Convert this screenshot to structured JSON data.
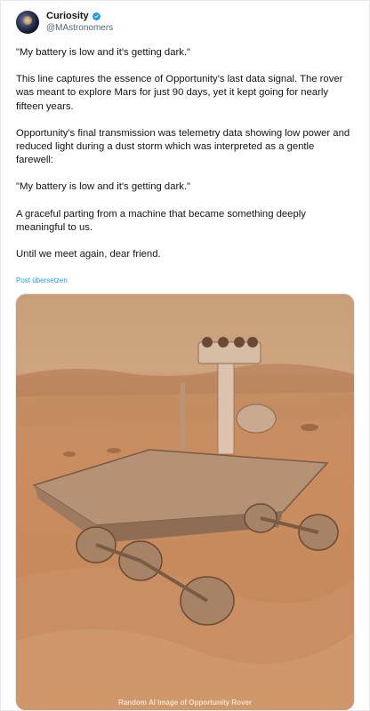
{
  "author": {
    "display_name": "Curiosity",
    "handle": "@MAstronomers",
    "avatar_icon": "avatar-icon",
    "verified_icon": "verified-badge-icon"
  },
  "post": {
    "paragraphs": [
      "\"My battery is low and it's getting dark.\"",
      "This line captures the essence of Opportunity's last data signal. The rover was meant to explore Mars for just 90 days, yet it kept going for nearly fifteen years.",
      "Opportunity's final transmission was telemetry data showing low power and reduced light during a dust storm which was interpreted as a gentle farewell:",
      "\"My battery is low and it's getting dark.\"",
      "A graceful parting from a machine that became something deeply meaningful to us.",
      "Until we meet again, dear friend."
    ],
    "translate_link": "Post übersetzen"
  },
  "media": {
    "caption": "Random AI Image of Opportunity Rover"
  },
  "colors": {
    "link": "#1d9bf0",
    "secondary_text": "#536471",
    "mars_sand": "#c78a5c"
  }
}
